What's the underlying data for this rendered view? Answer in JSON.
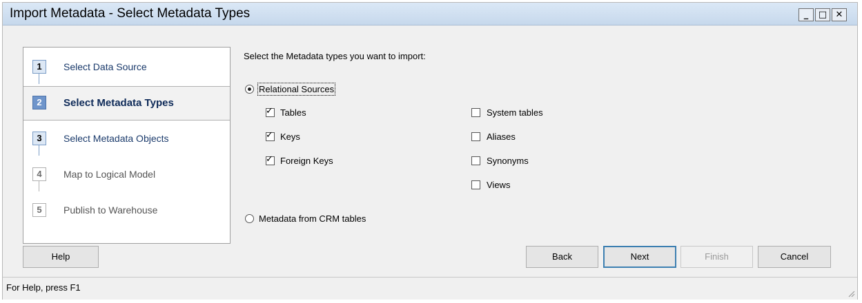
{
  "window": {
    "title": "Import Metadata - Select Metadata Types",
    "controls": {
      "minimize": "_",
      "maximize": "□",
      "close": "✕"
    }
  },
  "steps": [
    {
      "number": "1",
      "label": "Select Data Source",
      "state": "completed"
    },
    {
      "number": "2",
      "label": "Select Metadata Types",
      "state": "current"
    },
    {
      "number": "3",
      "label": "Select Metadata Objects",
      "state": "available"
    },
    {
      "number": "4",
      "label": "Map to Logical Model",
      "state": "disabled"
    },
    {
      "number": "5",
      "label": "Publish to Warehouse",
      "state": "disabled"
    }
  ],
  "main": {
    "prompt": "Select the Metadata types you want to import:",
    "relational": {
      "label": "Relational Sources",
      "selected": true
    },
    "crm": {
      "label": "Metadata from CRM tables",
      "selected": false
    },
    "checkboxes_left": [
      {
        "label": "Tables",
        "checked": true
      },
      {
        "label": "Keys",
        "checked": true
      },
      {
        "label": "Foreign Keys",
        "checked": true
      }
    ],
    "checkboxes_right": [
      {
        "label": "System tables",
        "checked": false
      },
      {
        "label": "Aliases",
        "checked": false
      },
      {
        "label": "Synonyms",
        "checked": false
      },
      {
        "label": "Views",
        "checked": false
      }
    ]
  },
  "buttons": {
    "help": "Help",
    "back": "Back",
    "next": "Next",
    "finish": "Finish",
    "cancel": "Cancel"
  },
  "status": {
    "text": "For Help, press F1"
  }
}
